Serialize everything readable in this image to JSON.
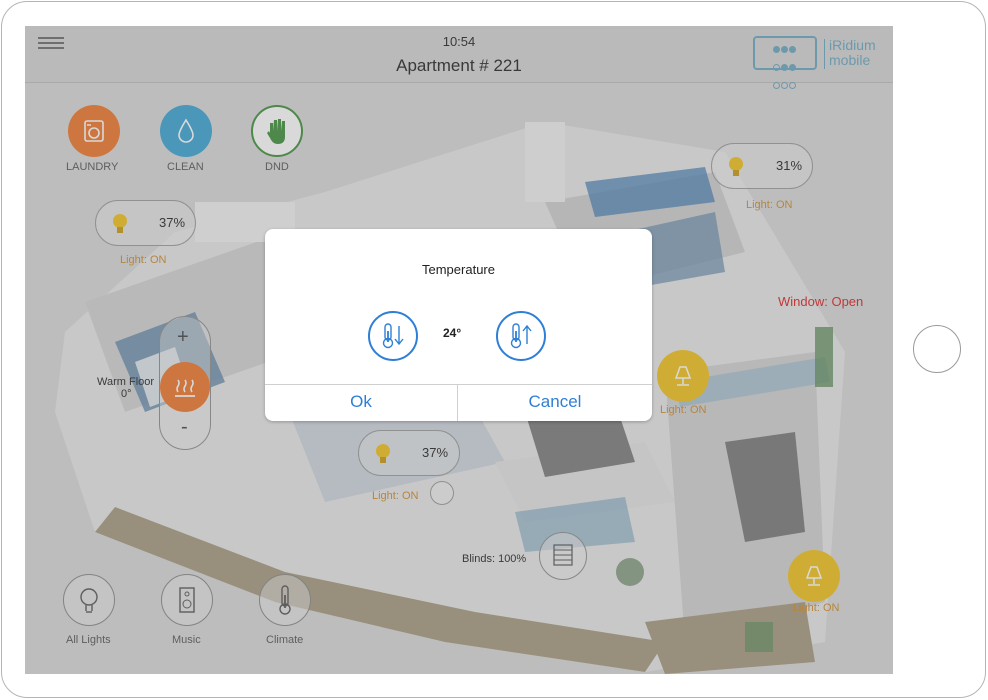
{
  "status_bar": {
    "time": "10:54"
  },
  "header": {
    "title": "Apartment # 221",
    "logo_line1": "iRidium",
    "logo_line2": "mobile"
  },
  "services": [
    {
      "label": "LAUNDRY",
      "icon": "washing-machine-icon",
      "color": "#f0772b"
    },
    {
      "label": "CLEAN",
      "icon": "water-drop-icon",
      "color": "#3aa4d3"
    },
    {
      "label": "DND",
      "icon": "hand-stop-icon",
      "color": "#3f8f3a"
    }
  ],
  "lights": [
    {
      "value": "37%",
      "status": "Light: ON"
    },
    {
      "value": "31%",
      "status": "Light: ON"
    },
    {
      "value": "37%",
      "status": "Light: ON"
    }
  ],
  "lamps": [
    {
      "status": "Light: ON"
    },
    {
      "status": "Light: ON"
    }
  ],
  "window_status": "Window: Open",
  "warm_floor": {
    "label": "Warm Floor",
    "value": "0°",
    "plus": "+",
    "minus": "-"
  },
  "blinds": {
    "label": "Blinds: 100%"
  },
  "bottom_nav": [
    {
      "label": "All Lights",
      "icon": "lightbulb-icon"
    },
    {
      "label": "Music",
      "icon": "speaker-icon"
    },
    {
      "label": "Climate",
      "icon": "thermometer-icon"
    }
  ],
  "dialog": {
    "title": "Temperature",
    "value": "24°",
    "ok_label": "Ok",
    "cancel_label": "Cancel"
  },
  "colors": {
    "accent": "#2e7fd6",
    "lamp_yellow": "#f2c21b",
    "light_status": "#cf8b2a",
    "alert_red": "#e02020"
  }
}
